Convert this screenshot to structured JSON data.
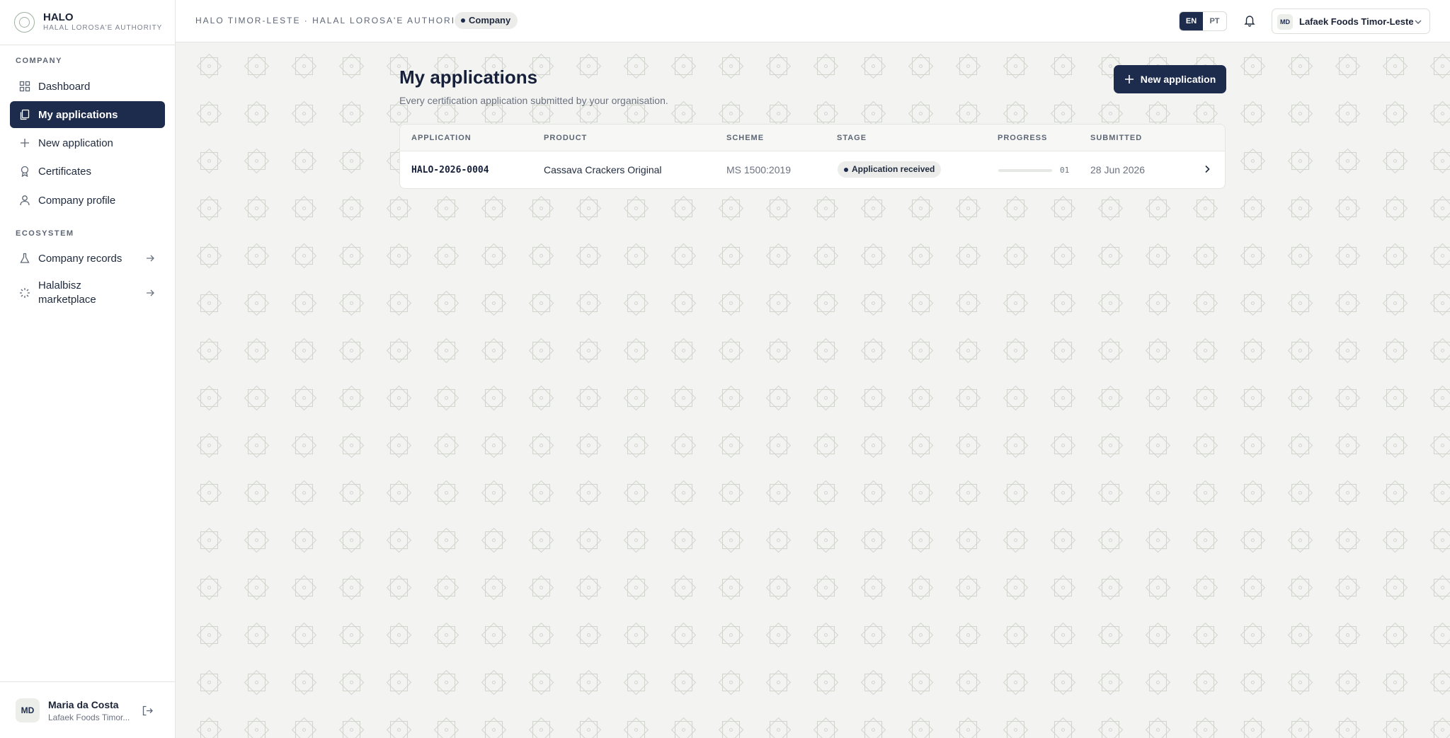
{
  "brand": {
    "name": "HALO",
    "subtitle": "HALAL LOROSA'E AUTHORITY"
  },
  "sidebar": {
    "company_section": "COMPANY",
    "items": [
      {
        "label": "Dashboard",
        "icon": "grid-icon"
      },
      {
        "label": "My applications",
        "icon": "copy-icon",
        "active": true
      },
      {
        "label": "New application",
        "icon": "plus-icon"
      },
      {
        "label": "Certificates",
        "icon": "award-icon"
      },
      {
        "label": "Company profile",
        "icon": "user-icon"
      }
    ],
    "ecosystem_section": "ECOSYSTEM",
    "ecosystem_items": [
      {
        "label": "Company records",
        "icon": "flask-icon"
      },
      {
        "label": "Halalbisz marketplace",
        "icon": "sparkle-icon"
      }
    ]
  },
  "user": {
    "initials": "MD",
    "name": "Maria da Costa",
    "org": "Lafaek Foods Timor..."
  },
  "topbar": {
    "breadcrumb": "HALO TIMOR-LESTE · HALAL LOROSA'E AUTHORITY",
    "role": "Company",
    "lang_en": "EN",
    "lang_pt": "PT",
    "org_initials": "MD",
    "org_name": "Lafaek Foods Timor-Leste"
  },
  "page": {
    "title": "My applications",
    "subtitle": "Every certification application submitted by your organisation.",
    "new_button": "New application"
  },
  "table": {
    "columns": [
      "APPLICATION",
      "PRODUCT",
      "SCHEME",
      "STAGE",
      "PROGRESS",
      "SUBMITTED"
    ],
    "rows": [
      {
        "application": "HALO-2026-0004",
        "product": "Cassava Crackers Original",
        "scheme": "MS 1500:2019",
        "stage": "Application received",
        "progress_label": "01",
        "progress_fraction": 0.0,
        "submitted": "28 Jun 2026"
      }
    ]
  },
  "colors": {
    "primary": "#1d2b4c",
    "background": "#f3f4f1",
    "pattern": "#c9ccc5"
  }
}
